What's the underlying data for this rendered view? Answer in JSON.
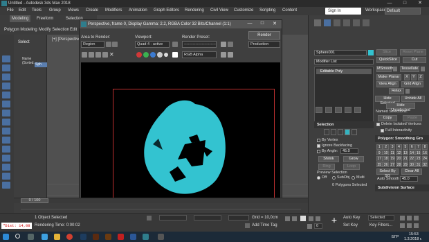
{
  "window": {
    "title": "Untitled - Autodesk 3ds Max 2018",
    "controls": [
      "—",
      "□",
      "✕"
    ]
  },
  "menubar": {
    "items": [
      "File",
      "Edit",
      "Tools",
      "Group",
      "Views",
      "Create",
      "Modifiers",
      "Animation",
      "Graph Editors",
      "Rendering",
      "Civil View",
      "Customize",
      "Scripting",
      "Content"
    ],
    "signin": "Sign In",
    "workspace_label": "Workspaces:",
    "workspace_value": "Default"
  },
  "ribbon": {
    "tabs": [
      "Modeling",
      "Freeform",
      "Selection"
    ],
    "sub": [
      "Polygon Modeling",
      "Modify Selection",
      "Edit"
    ]
  },
  "explorer": {
    "header": "Select",
    "row1": "Name (Sorted...",
    "row2": "Sph"
  },
  "viewport": {
    "label": "[+] [Perspective..."
  },
  "render_frame": {
    "title": "Perspective, frame 0, Display Gamma: 2.2, RGBA Color 32 Bits/Channel (1:1)",
    "area_label": "Area to Render:",
    "area_value": "Region",
    "viewport_label": "Viewport:",
    "viewport_value": "Quad 4 - active",
    "preset_label": "Render Preset:",
    "preset_value": "-------------------------",
    "render_button": "Render",
    "production_value": "Production",
    "channel_value": "RGB Alpha"
  },
  "command_panel": {
    "object_name": "Sphere001",
    "modifier_list": "Modifier List",
    "stack_item": "Editable Poly",
    "selection_title": "Selection",
    "by_vertex": "By Vertex",
    "ignore_backfacing": "Ignore Backfacing",
    "by_angle_label": "By Angle:",
    "by_angle_value": "45.0",
    "shrink": "Shrink",
    "grow": "Grow",
    "ring": "Ring",
    "loop": "Loop",
    "preview_label": "Preview Selection",
    "preview_off": "Off",
    "preview_subobj": "SubObj",
    "preview_multi": "Multi",
    "selected_info": "0 Polygons Selected",
    "right_buttons": [
      "Slice",
      "Reset Plane",
      "QuickSlice",
      "Cut",
      "MSmooth",
      "Tessellate",
      "Make Planar",
      "X",
      "Y",
      "Z",
      "View Align",
      "Grid Align",
      "Relax",
      "Hide Selected",
      "Unhide All",
      "Hide Unselected"
    ],
    "named_sel_label": "Named Selections:",
    "copy": "Copy",
    "paste": "Paste",
    "delete_isolated": "Delete Isolated Vertices",
    "full_interactivity": "Full Interactivity",
    "smoothing_title": "Polygon: Smoothing Gro",
    "smoothing_groups": [
      "1",
      "2",
      "3",
      "4",
      "5",
      "6",
      "7",
      "8",
      "9",
      "10",
      "11",
      "12",
      "13",
      "14",
      "15",
      "16",
      "17",
      "18",
      "19",
      "20",
      "21",
      "22",
      "23",
      "24",
      "25",
      "26",
      "27",
      "28",
      "29",
      "30",
      "31",
      "32"
    ],
    "select_by_sg": "Select By SG",
    "clear_all": "Clear All",
    "auto_smooth": "Auto Smooth",
    "auto_smooth_value": "45.0",
    "subdiv_title": "Subdivision Surface"
  },
  "timeline": {
    "frame": "0 / 100"
  },
  "status": {
    "maxscript": "\"Dist: 14,08",
    "line1": "1 Object Selected",
    "line2": "Rendering Time: 0:00:02",
    "grid": "Grid = 10,0cm",
    "add_time_tag": "Add Time Tag",
    "autokey": "Auto Key",
    "selected": "Selected",
    "setkey": "Set Key",
    "keyfilters": "Key Filters...",
    "frame_value": "0"
  },
  "taskbar": {
    "lang": "БГР",
    "time": "15:53",
    "date": "1.3.2018 г."
  },
  "colors": {
    "accent_blue": "#4a6fa0",
    "sphere_cyan": "#33c3d0",
    "safe_frame_red": "#c03030"
  }
}
